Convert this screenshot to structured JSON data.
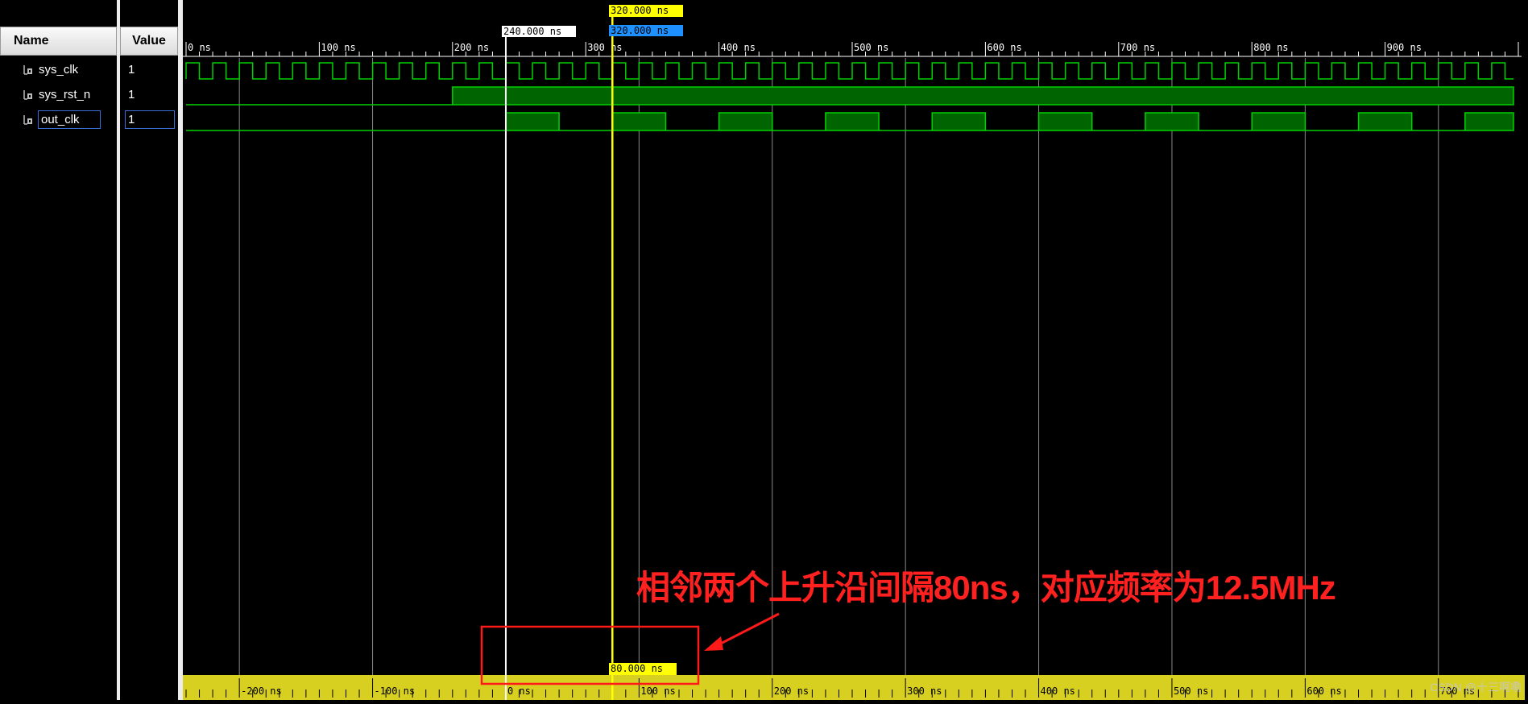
{
  "panes": {
    "name_header": "Name",
    "value_header": "Value"
  },
  "signals": [
    {
      "name": "sys_clk",
      "value": "1",
      "selected": false
    },
    {
      "name": "sys_rst_n",
      "value": "1",
      "selected": false
    },
    {
      "name": "out_clk",
      "value": "1",
      "selected": true
    }
  ],
  "timeline": {
    "top_tick_labels": [
      "0 ns",
      "100 ns",
      "200 ns",
      "300 ns",
      "400 ns",
      "500 ns",
      "600 ns",
      "700 ns",
      "800 ns",
      "900 ns"
    ],
    "bottom_tick_labels": [
      "-200 ns",
      "-100 ns",
      "0 ns",
      "100 ns",
      "200 ns",
      "300 ns",
      "400 ns",
      "500 ns",
      "600 ns",
      "700 ns"
    ]
  },
  "cursors": {
    "primary_label": "320.000 ns",
    "primary_label_blue": "320.000 ns",
    "marker_label": "240.000 ns",
    "delta_label": "80.000 ns"
  },
  "annotation": {
    "text": "相邻两个上升沿间隔80ns，对应频率为12.5MHz",
    "color": "#ff2020"
  },
  "watermark": "CSDN @十三啊嘞",
  "colors": {
    "wave": "#00d000",
    "wave_fill": "#006400",
    "cursor_yellow": "#ffff00",
    "marker_white": "#ffffff",
    "grid": "#8a8a8a",
    "bottom_bar": "#d8d020",
    "value_selected_border": "#3a6fd8"
  },
  "icons": {
    "signal": "signal-bit-icon",
    "scroll_up": "scroll-up-icon"
  }
}
